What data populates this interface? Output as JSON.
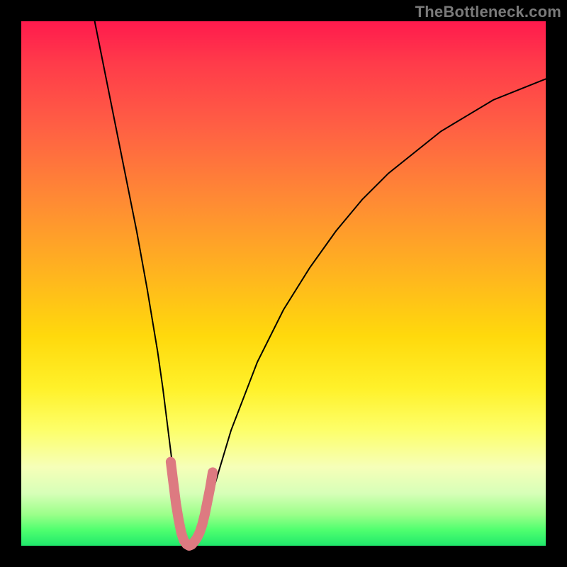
{
  "watermark": "TheBottleneck.com",
  "chart_data": {
    "type": "line",
    "title": "",
    "xlabel": "",
    "ylabel": "",
    "xlim": [
      0,
      100
    ],
    "ylim": [
      0,
      100
    ],
    "grid": false,
    "legend": false,
    "series": [
      {
        "name": "bottleneck-curve",
        "x": [
          14,
          16,
          18,
          20,
          22,
          24,
          26,
          27,
          28,
          29,
          30,
          31,
          32,
          33,
          34,
          35,
          37,
          40,
          45,
          50,
          55,
          60,
          65,
          70,
          75,
          80,
          85,
          90,
          95,
          100
        ],
        "values": [
          100,
          90,
          80,
          70,
          60,
          49,
          37,
          30,
          22,
          14,
          7,
          2,
          0,
          0,
          1,
          4,
          12,
          22,
          35,
          45,
          53,
          60,
          66,
          71,
          75,
          79,
          82,
          85,
          87,
          89
        ]
      },
      {
        "name": "trough-marker",
        "x": [
          28.5,
          29,
          29.5,
          30,
          30.5,
          31,
          31.5,
          32,
          32.5,
          33,
          33.5,
          34,
          34.5,
          35,
          35.5,
          36,
          36.5
        ],
        "values": [
          16,
          12,
          8,
          5,
          2.5,
          1,
          0.3,
          0,
          0.2,
          0.8,
          1.5,
          2.5,
          4,
          6,
          8.5,
          11,
          14
        ]
      }
    ],
    "colors": {
      "curve": "#000000",
      "marker": "#dd7a81",
      "gradient_top": "#ff1a4d",
      "gradient_bottom": "#20e86b"
    }
  }
}
